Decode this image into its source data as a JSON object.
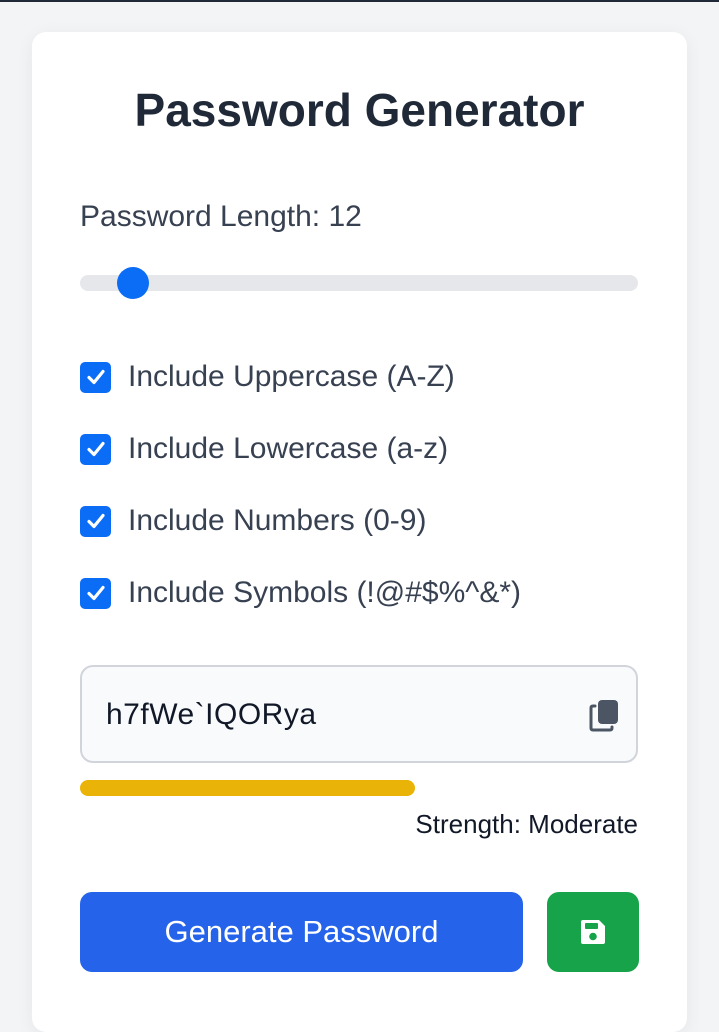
{
  "title": "Password Generator",
  "length": {
    "label": "Password Length: 12",
    "value": 12,
    "slider_fraction": 0.095
  },
  "options": [
    {
      "label": "Include Uppercase (A-Z)",
      "checked": true
    },
    {
      "label": "Include Lowercase (a-z)",
      "checked": true
    },
    {
      "label": "Include Numbers (0-9)",
      "checked": true
    },
    {
      "label": "Include Symbols (!@#$%^&*)",
      "checked": true
    }
  ],
  "password": {
    "value": "h7fWe`IQORya",
    "copy_icon": "copy-icon"
  },
  "strength": {
    "text": "Strength: Moderate",
    "fraction": 0.6,
    "color": "#eab308"
  },
  "buttons": {
    "generate_label": "Generate Password",
    "save_icon": "floppy-disk-icon"
  },
  "colors": {
    "accent": "#0b6cf5",
    "primary_button": "#2563eb",
    "save_button": "#16a34a"
  }
}
